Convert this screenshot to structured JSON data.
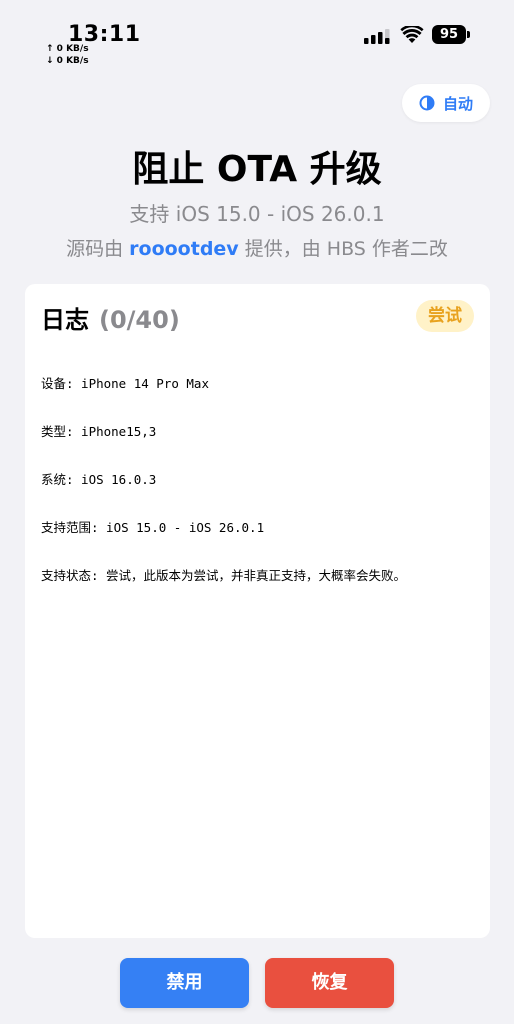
{
  "status_bar": {
    "time": "13:11",
    "net_up": "↑ 0 KB/s",
    "net_down": "↓ 0 KB/s",
    "battery": "95",
    "icons": [
      "cellular-signal-icon",
      "wifi-icon",
      "battery-icon"
    ]
  },
  "theme_toggle": {
    "icon": "half-circle-contrast-icon",
    "label": "自动"
  },
  "header": {
    "title": "阻止 OTA 升级",
    "subtitle": "支持 iOS 15.0 - iOS 26.0.1",
    "credit_prefix": "源码由 ",
    "credit_author": "rooootdev",
    "credit_suffix": " 提供，由 HBS 作者二改"
  },
  "log": {
    "title": "日志",
    "count": "(0/40)",
    "status_badge": "尝试",
    "lines": [
      "设备: iPhone 14 Pro Max",
      "类型: iPhone15,3",
      "系统: iOS 16.0.3",
      "支持范围: iOS 15.0 - iOS 26.0.1",
      "支持状态: 尝试，此版本为尝试，并非真正支持，大概率会失败。"
    ]
  },
  "actions": {
    "disable_label": "禁用",
    "restore_label": "恢复"
  },
  "colors": {
    "background": "#f2f2f6",
    "accent": "#2f7cf6",
    "disable_button": "#3580f4",
    "restore_button": "#e9503f",
    "badge_bg": "#fff2c8",
    "badge_text": "#e8a21e",
    "secondary_text": "#8a8a8e"
  }
}
